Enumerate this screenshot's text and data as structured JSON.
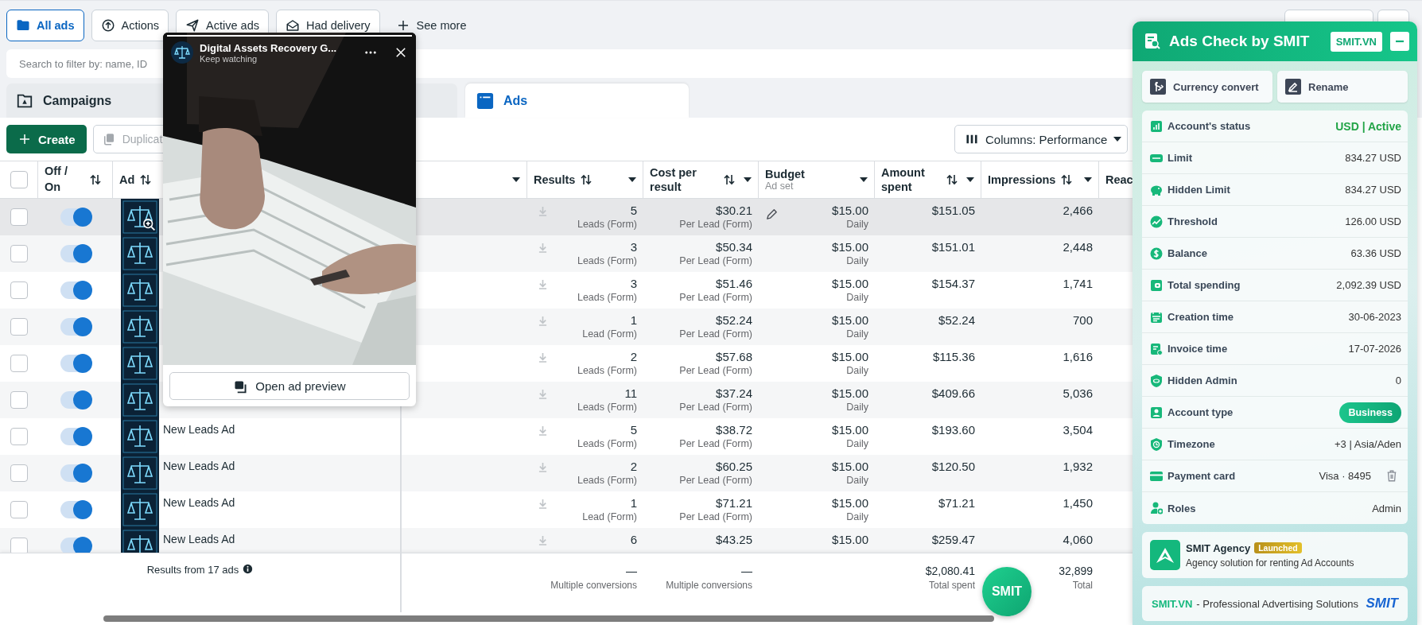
{
  "filters": [
    {
      "label": "All ads",
      "selected": true
    },
    {
      "label": "Actions",
      "selected": false
    },
    {
      "label": "Active ads",
      "selected": false
    },
    {
      "label": "Had delivery",
      "selected": false
    }
  ],
  "see_more": "See more",
  "search": {
    "placeholder": "Search to filter by: name, ID"
  },
  "tabs": [
    {
      "label": "Campaigns",
      "selected": false
    },
    {
      "label": "Ads",
      "selected": true
    }
  ],
  "toolbar": {
    "create": "Create",
    "duplicate": {
      "label": "Duplicat",
      "disabled": true
    },
    "columns": "Columns: Performance"
  },
  "table": {
    "select_all": {
      "checked": false
    },
    "columns": [
      {
        "label": "Off / On",
        "sortable": true,
        "menu": false
      },
      {
        "label": "Ad",
        "sortable": true,
        "menu": true
      },
      {
        "label": "Results",
        "sortable": true,
        "menu": true
      },
      {
        "label": "Cost per result",
        "sortable": true,
        "menu": true
      },
      {
        "label": "Budget",
        "sub": "Ad set",
        "sortable": false,
        "menu": true
      },
      {
        "label": "Amount spent",
        "sortable": true,
        "menu": true
      },
      {
        "label": "Impressions",
        "sortable": true,
        "menu": true
      },
      {
        "label": "Reac"
      }
    ],
    "rows": [
      {
        "checked": false,
        "on": true,
        "highlighted": true,
        "results": "5",
        "result_type": "Leads (Form)",
        "cost": "$30.21",
        "cost_type": "Per Lead (Form)",
        "budget": "$15.00",
        "budget_type": "Daily",
        "spent": "$151.05",
        "impressions": "2,466"
      },
      {
        "checked": false,
        "on": true,
        "highlighted": false,
        "results": "3",
        "result_type": "Leads (Form)",
        "cost": "$50.34",
        "cost_type": "Per Lead (Form)",
        "budget": "$15.00",
        "budget_type": "Daily",
        "spent": "$151.01",
        "impressions": "2,448"
      },
      {
        "checked": false,
        "on": true,
        "highlighted": false,
        "results": "3",
        "result_type": "Leads (Form)",
        "cost": "$51.46",
        "cost_type": "Per Lead (Form)",
        "budget": "$15.00",
        "budget_type": "Daily",
        "spent": "$154.37",
        "impressions": "1,741"
      },
      {
        "checked": false,
        "on": true,
        "highlighted": false,
        "results": "1",
        "result_type": "Lead (Form)",
        "cost": "$52.24",
        "cost_type": "Per Lead (Form)",
        "budget": "$15.00",
        "budget_type": "Daily",
        "spent": "$52.24",
        "impressions": "700"
      },
      {
        "checked": false,
        "on": true,
        "highlighted": false,
        "results": "2",
        "result_type": "Leads (Form)",
        "cost": "$57.68",
        "cost_type": "Per Lead (Form)",
        "budget": "$15.00",
        "budget_type": "Daily",
        "spent": "$115.36",
        "impressions": "1,616"
      },
      {
        "checked": false,
        "on": true,
        "highlighted": false,
        "results": "11",
        "result_type": "Leads (Form)",
        "cost": "$37.24",
        "cost_type": "Per Lead (Form)",
        "budget": "$15.00",
        "budget_type": "Daily",
        "spent": "$409.66",
        "impressions": "5,036"
      },
      {
        "checked": false,
        "on": true,
        "highlighted": false,
        "name": "New Leads Ad",
        "results": "5",
        "result_type": "Leads (Form)",
        "cost": "$38.72",
        "cost_type": "Per Lead (Form)",
        "budget": "$15.00",
        "budget_type": "Daily",
        "spent": "$193.60",
        "impressions": "3,504"
      },
      {
        "checked": false,
        "on": true,
        "highlighted": false,
        "name": "New Leads Ad",
        "results": "2",
        "result_type": "Leads (Form)",
        "cost": "$60.25",
        "cost_type": "Per Lead (Form)",
        "budget": "$15.00",
        "budget_type": "Daily",
        "spent": "$120.50",
        "impressions": "1,932"
      },
      {
        "checked": false,
        "on": true,
        "highlighted": false,
        "name": "New Leads Ad",
        "results": "1",
        "result_type": "Lead (Form)",
        "cost": "$71.21",
        "cost_type": "Per Lead (Form)",
        "budget": "$15.00",
        "budget_type": "Daily",
        "spent": "$71.21",
        "impressions": "1,450"
      },
      {
        "checked": false,
        "on": true,
        "highlighted": false,
        "name": "New Leads Ad",
        "results": "6",
        "cost": "$43.25",
        "budget": "$15.00",
        "spent": "$259.47",
        "impressions": "4,060"
      }
    ],
    "summary": {
      "label": "Results from 17 ads",
      "results": {
        "value": "—",
        "caption": "Multiple conversions"
      },
      "cost": {
        "value": "—",
        "caption": "Multiple conversions"
      },
      "spent": {
        "value": "$2,080.41",
        "caption": "Total spent"
      },
      "impressions": {
        "value": "32,899",
        "caption": "Total"
      }
    }
  },
  "popup": {
    "title": "Digital Assets Recovery G...",
    "subtitle": "Keep watching",
    "progress": {
      "level": 1
    },
    "button": "Open ad preview"
  },
  "panel": {
    "title": "Ads Check by SMIT",
    "link": "SMIT.VN",
    "actions": [
      "Currency convert",
      "Rename"
    ],
    "fields": [
      {
        "kind": "status",
        "label": "Account's status",
        "value": "USD | Active"
      },
      {
        "kind": "text",
        "label": "Limit",
        "value": "834.27 USD"
      },
      {
        "kind": "text",
        "label": "Hidden Limit",
        "value": "834.27 USD"
      },
      {
        "kind": "text",
        "label": "Threshold",
        "value": "126.00 USD"
      },
      {
        "kind": "text",
        "label": "Balance",
        "value": "63.36 USD"
      },
      {
        "kind": "text",
        "label": "Total spending",
        "value": "2,092.39 USD"
      },
      {
        "kind": "text",
        "label": "Creation time",
        "value": "30-06-2023"
      },
      {
        "kind": "text",
        "label": "Invoice time",
        "value": "17-07-2026"
      },
      {
        "kind": "text",
        "label": "Hidden Admin",
        "value": "0"
      },
      {
        "kind": "pill",
        "label": "Account type",
        "value": "Business"
      },
      {
        "kind": "text",
        "label": "Timezone",
        "value": "+3 | Asia/Aden"
      },
      {
        "kind": "card",
        "label": "Payment card",
        "value": "Visa · 8495"
      },
      {
        "kind": "text",
        "label": "Roles",
        "value": "Admin"
      }
    ],
    "promo": {
      "title": "SMIT Agency",
      "badge": "Launched",
      "text": "Agency solution for renting Ad Accounts"
    },
    "footer": {
      "brand": "SMIT.VN",
      "tagline": "- Professional Advertising Solutions",
      "logo": "SMIT"
    }
  },
  "fab": "SMIT"
}
